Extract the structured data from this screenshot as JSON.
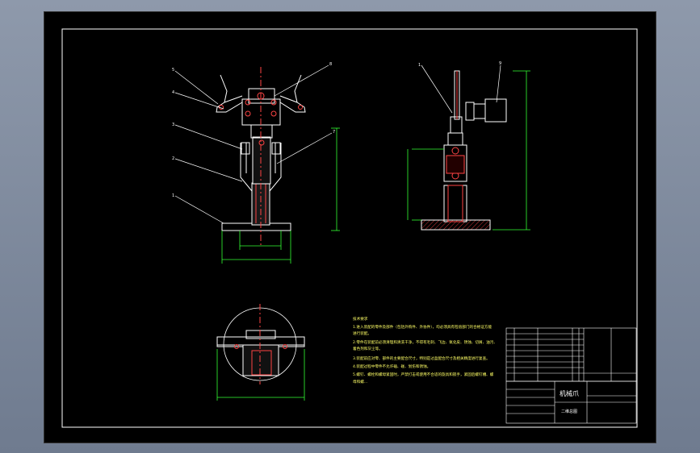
{
  "title_block": {
    "name": "机械爪",
    "subtitle": "二维总图"
  },
  "notes": {
    "heading": "技术要求",
    "lines": [
      "1.进入装配的零件及部件（包括外购件、外协件），均必须具有检验部门的合格证方能",
      "进行装配。",
      "2.零件在装配前必须清理和清洗干净，不得有毛刺、飞边、氧化皮、锈蚀、切屑、油污、",
      "着色剂和灰尘等。",
      "3.装配前应对零、部件的主要配合尺寸，特别是过盈配合尺寸及相关精度进行复查。",
      "4.装配过程中零件不允许磕、碰、划伤和锈蚀。",
      "5.螺钉、螺栓和螺母紧固时，严禁打击或使用不合适的旋具和扳手，紧固后螺钉槽、螺",
      "母和螺..."
    ]
  },
  "balloons": {
    "front": [
      "5",
      "4",
      "3",
      "2",
      "1",
      "8",
      "7"
    ],
    "side": [
      "1",
      "9"
    ]
  },
  "colors": {
    "background": "#000000",
    "outer": "#7b879a",
    "geometry": "#ffffff",
    "dimension": "#33ff33",
    "hatch": "#ff4444",
    "text": "#ffff66"
  }
}
